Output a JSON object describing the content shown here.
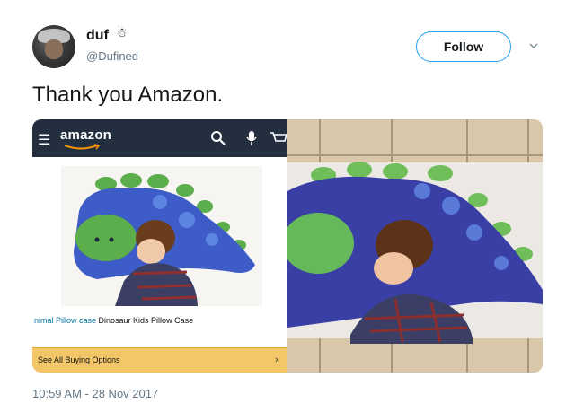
{
  "tweet": {
    "display_name": "duf",
    "emoji": "☃",
    "handle": "@Dufined",
    "follow_label": "Follow",
    "text": "Thank you Amazon.",
    "timestamp": "10:59 AM - 28 Nov 2017"
  },
  "amazon_screenshot": {
    "logo": "amazon",
    "caption_link": "nimal Pillow case",
    "caption_rest": " Dinosaur Kids Pillow Case",
    "buy_label": "See All Buying Options",
    "buy_arrow": "›"
  },
  "icons": [
    "chevron-down-icon",
    "menu-icon",
    "search-icon",
    "mic-icon",
    "cart-icon"
  ],
  "colors": {
    "twitter_blue": "#1da1f2",
    "amazon_header": "#232f3e",
    "amazon_button": "#f3c768",
    "secondary_text": "#657786"
  }
}
